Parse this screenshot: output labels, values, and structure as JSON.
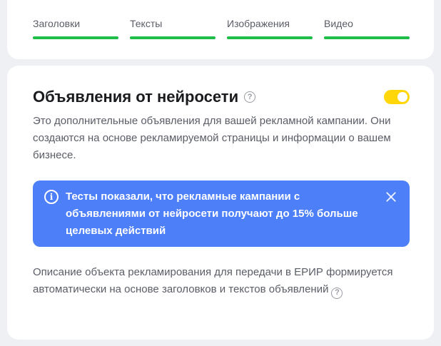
{
  "quality": {
    "items": [
      {
        "label": "Заголовки",
        "progress": 1.0
      },
      {
        "label": "Тексты",
        "progress": 1.0
      },
      {
        "label": "Изображения",
        "progress": 1.0
      },
      {
        "label": "Видео",
        "progress": 1.0
      }
    ],
    "bar_color": "#1fbd4a"
  },
  "neural_ads": {
    "title": "Объявления от нейросети",
    "help_glyph": "?",
    "toggle_on": true,
    "toggle_color": "#ffd60a",
    "description": "Это дополнительные объявления для вашей рекламной кампании. Они создаются на основе рекламируемой страницы и информации о вашем бизнесе."
  },
  "banner": {
    "icon_glyph": "i",
    "text": "Тесты показали, что рекламные кампании с объявлениями от нейросети получают до 15% больше целевых действий",
    "background": "#4c7ff8"
  },
  "erir": {
    "text": "Описание объекта рекламирования для передачи в ЕРИР формируется автоматически на основе заголовков и текстов объявлений",
    "help_glyph": "?"
  }
}
